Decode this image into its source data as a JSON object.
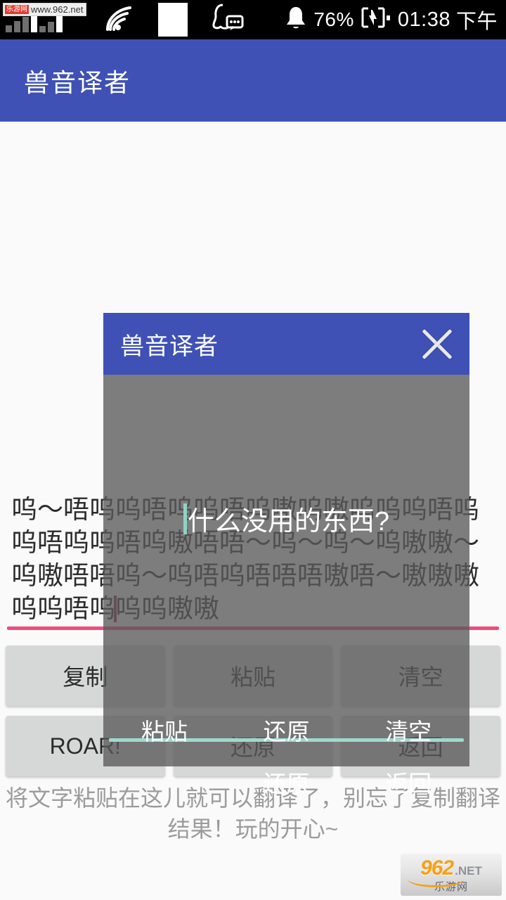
{
  "statusbar": {
    "carrier_watermark": {
      "badge": "乐游网",
      "url": "www.962.net"
    },
    "signal_icon": "signal-bars-icon",
    "wifi_icon": "wifi-icon",
    "blank_icon": "blank-notification-icon",
    "qq_icon": "qq-message-icon",
    "alarm_icon": "alarm-bell-icon",
    "battery_percent": "76%",
    "battery_icon": "battery-charging-icon",
    "time": "01:38",
    "ampm": "下午"
  },
  "appbar": {
    "title": "兽音译者"
  },
  "main": {
    "translated_text_line1": "呜～唔呜呜唔呜呜唔呜嗷呜嗷",
    "translated_text_line2": "呜呜呜唔呜呜唔呜呜唔呜嗷唔唔～",
    "translated_text_line3": "呜～呜～呜嗷嗷～呜嗷唔唔呜～呜唔呜",
    "translated_text_line4a": "唔唔唔嗷唔～嗷嗷嗷呜呜唔呜",
    "translated_text_line4b": "呜呜嗷嗷",
    "hint": "将文字粘贴在这儿就可以翻译了，别忘了复制翻译结果！玩的开心~",
    "buttons_row1": [
      "复制",
      "粘贴",
      "清空"
    ],
    "buttons_row2": [
      "ROAR!",
      "还原",
      "返回"
    ]
  },
  "dialog": {
    "title": "兽音译者",
    "close_icon": "close-x-icon",
    "input_value": "什么没用的东西?",
    "buttons_row1": [
      "粘贴",
      "还原",
      "清空"
    ],
    "buttons_row2": [
      "",
      "还原",
      "返回"
    ]
  },
  "watermark": {
    "logo_number": "962",
    "logo_tld": ".NET",
    "logo_cn": "乐游网"
  },
  "colors": {
    "primary": "#3f51b5",
    "accent_pink": "#ef4c80",
    "accent_teal": "#9fd9cf",
    "button_bg": "#d6d7d7",
    "scrim": "rgba(90,90,90,0.78)"
  }
}
